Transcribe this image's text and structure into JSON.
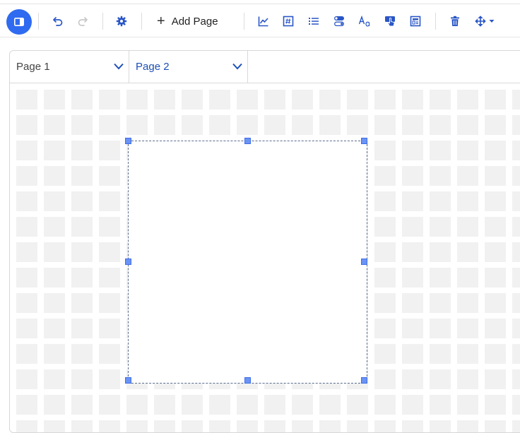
{
  "toolbar": {
    "panel_toggle_icon": "panel-icon",
    "undo_icon": "undo-icon",
    "redo_icon": "redo-icon",
    "settings_icon": "gear-icon",
    "add_page_label": "Add Page",
    "tools": [
      "line-chart-icon",
      "number-widget-icon",
      "list-icon",
      "toggle-icon",
      "text-icon",
      "touch-icon",
      "layout-icon"
    ],
    "delete_icon": "trash-icon",
    "move_icon": "move-icon",
    "accent_color": "#2f6bf0"
  },
  "tabs": [
    {
      "label": "Page 1",
      "active": false
    },
    {
      "label": "Page 2",
      "active": true
    }
  ],
  "canvas": {
    "grid_color": "#f1f1f1",
    "selection_handle_color": "#6a93f5"
  }
}
